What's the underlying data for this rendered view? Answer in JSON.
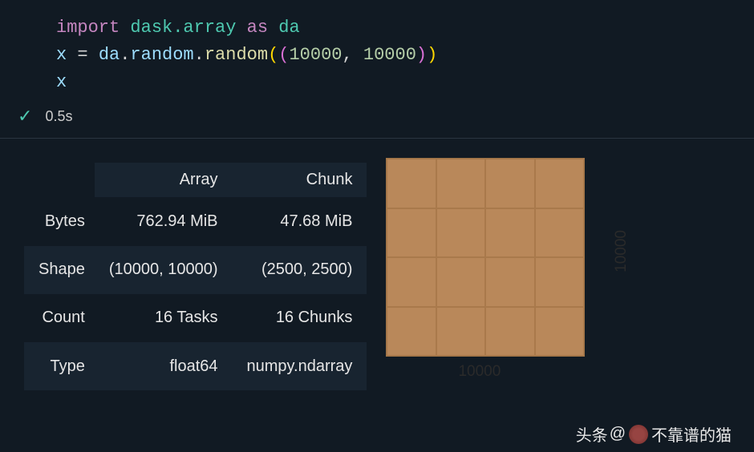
{
  "code": {
    "line1": {
      "import": "import",
      "module": "dask.array",
      "as": "as",
      "alias": "da"
    },
    "line2": {
      "var": "x",
      "eq": "=",
      "obj": "da",
      "attr": "random",
      "func": "random",
      "n1": "10000",
      "n2": "10000"
    },
    "line3": {
      "var": "x"
    }
  },
  "status": {
    "time": "0.5s"
  },
  "table": {
    "headers": {
      "col1": "",
      "col2": "Array",
      "col3": "Chunk"
    },
    "rows": [
      {
        "label": "Bytes",
        "array": "762.94 MiB",
        "chunk": "47.68 MiB"
      },
      {
        "label": "Shape",
        "array": "(10000, 10000)",
        "chunk": "(2500, 2500)"
      },
      {
        "label": "Count",
        "array": "16 Tasks",
        "chunk": "16 Chunks"
      },
      {
        "label": "Type",
        "array": "float64",
        "chunk": "numpy.ndarray"
      }
    ]
  },
  "viz": {
    "axis_x": "10000",
    "axis_y": "10000"
  },
  "watermark": {
    "prefix": "头条",
    "at": "@",
    "name": "不靠谱的猫"
  }
}
